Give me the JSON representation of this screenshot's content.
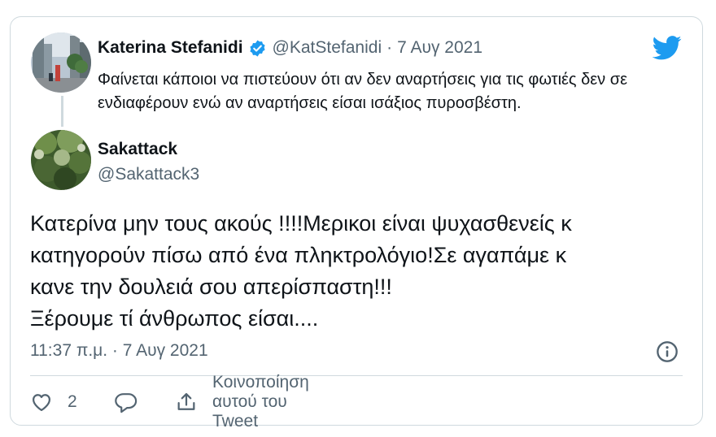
{
  "quoted_tweet": {
    "author_name": "Katerina Stefanidi",
    "verified_icon": "verified-badge-icon",
    "handle": "@KatStefanidi",
    "separator": "·",
    "date": "7 Αυγ 2021",
    "text": "Φαίνεται κάποιοι να πιστεύουν ότι αν δεν αναρτήσεις για τις φωτιές δεν σε ενδιαφέρουν ενώ αν αναρτήσεις είσαι ισάξιος πυροσβέστη."
  },
  "reply": {
    "author_name": "Sakattack",
    "handle": "@Sakattack3",
    "text_lines": [
      "Κατερίνα μην τους ακούς !!!!Μερικοι είναι ψυχασθενείς κ",
      "κατηγορούν πίσω από ένα πληκτρολόγιο!Σε αγαπάμε κ",
      "κανε την δουλειά σου απερίσπαστη!!!",
      "Ξέρουμε τί άνθρωπος είσαι...."
    ],
    "timestamp": "11:37 π.μ. · 7 Αυγ 2021"
  },
  "actions": {
    "like_count": "2",
    "share_label": "Κοινοποίηση αυτού του Tweet"
  },
  "colors": {
    "twitter_blue": "#1d9bf0",
    "text_primary": "#0f1419",
    "text_secondary": "#536471",
    "border": "#cfd9de"
  },
  "icons": [
    "twitter-bird-icon",
    "info-icon",
    "heart-icon",
    "reply-bubble-icon",
    "share-icon"
  ]
}
